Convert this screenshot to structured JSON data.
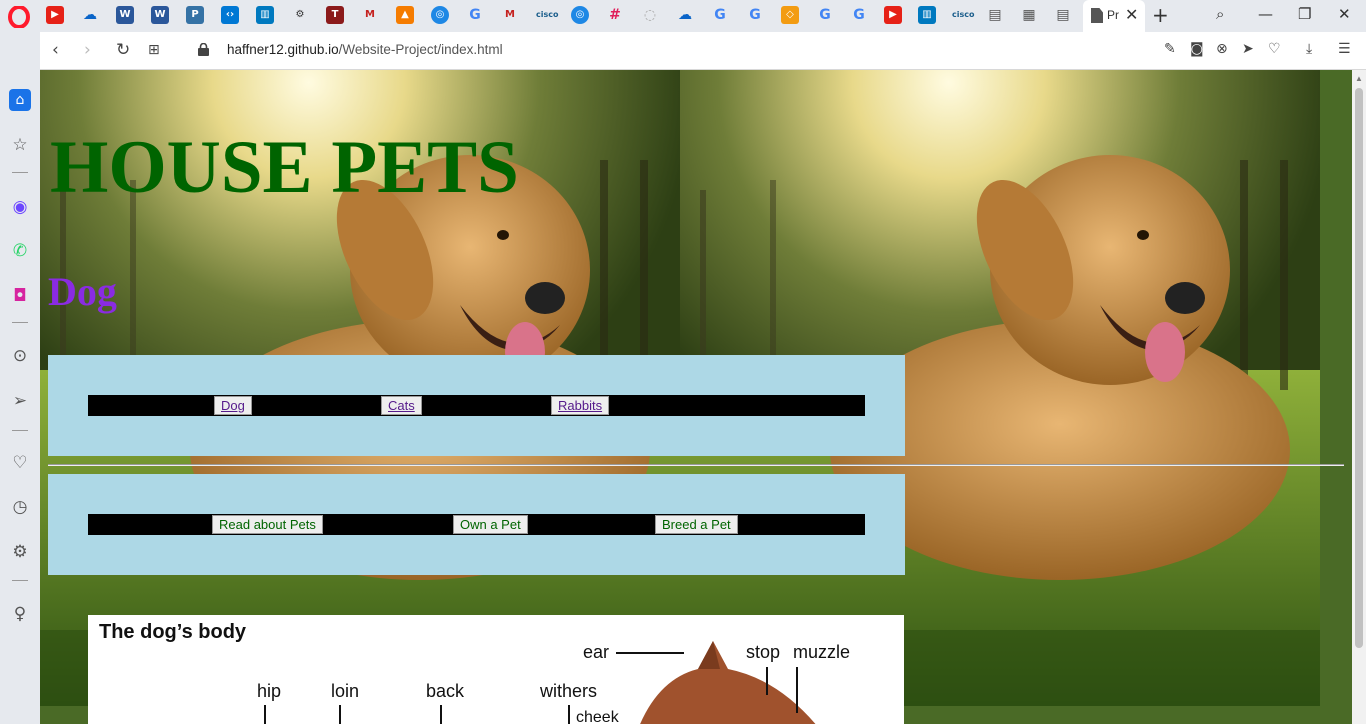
{
  "browser": {
    "active_tab_title": "Pr",
    "url_host": "haffner12.github.io",
    "url_path": "/Website-Project/index.html"
  },
  "page": {
    "heading": "HOUSE PETS",
    "subheading": "Dog",
    "nav_top": [
      {
        "label": "Dog"
      },
      {
        "label": "Cats"
      },
      {
        "label": "Rabbits"
      }
    ],
    "nav_bottom": [
      {
        "label": "Read about Pets"
      },
      {
        "label": "Own a Pet"
      },
      {
        "label": "Breed a Pet"
      }
    ],
    "anatomy": {
      "title": "The dog’s body",
      "labels": [
        "ear",
        "stop",
        "muzzle",
        "hip",
        "loin",
        "back",
        "withers",
        "cheek"
      ]
    }
  },
  "colors": {
    "heading": "#006400",
    "subheading": "#8a2be2",
    "nav_box": "#add8e6",
    "nav_bar": "#000000"
  }
}
